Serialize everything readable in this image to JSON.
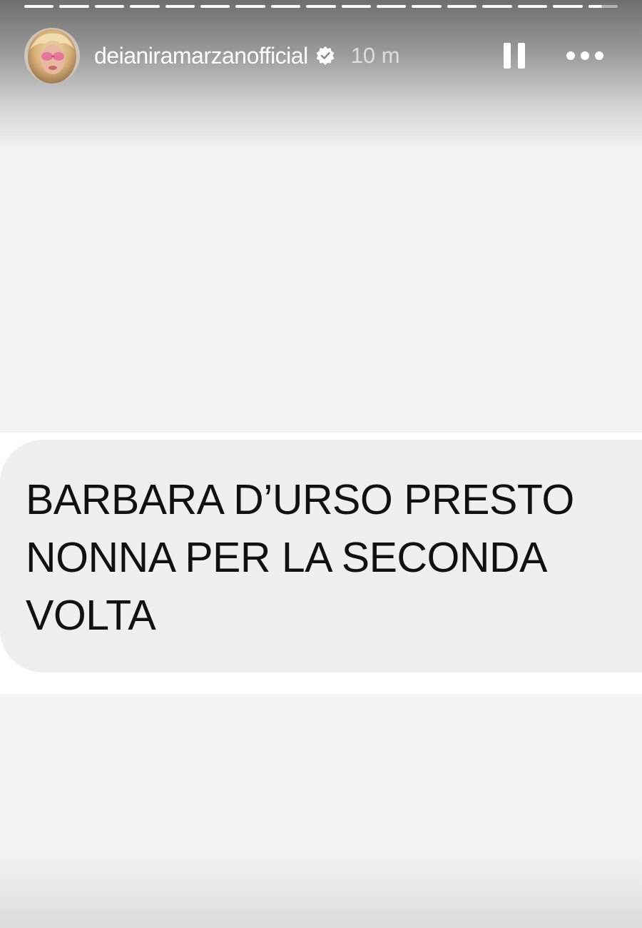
{
  "story": {
    "progress_segments": 17,
    "progress_current_fraction": 0.45,
    "header": {
      "avatar_icon": "avatar",
      "username": "deianiramarzanofficial",
      "verified_icon": "verified-badge-icon",
      "time_ago": "10 m",
      "pause_icon": "pause-icon",
      "more_icon": "more-options-icon"
    },
    "message": {
      "text": "BARBARA D’URSO PRESTO\nNONNA PER LA SECONDA\nVOLTA"
    },
    "colors": {
      "background": "#f4f4f4",
      "bubble": "#efefef",
      "text": "#111111",
      "header_text": "#ffffff"
    }
  }
}
